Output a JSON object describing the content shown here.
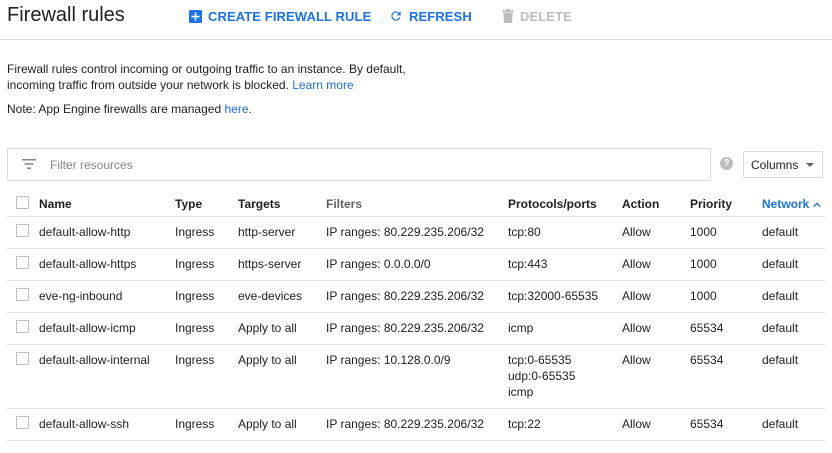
{
  "toolbar": {
    "title": "Firewall rules",
    "create_label": "CREATE FIREWALL RULE",
    "refresh_label": "REFRESH",
    "delete_label": "DELETE"
  },
  "description": {
    "line1": "Firewall rules control incoming or outgoing traffic to an instance. By default,",
    "line2": "incoming traffic from outside your network is blocked.",
    "learn_more": "Learn more"
  },
  "note": {
    "prefix": "Note: App Engine firewalls are managed ",
    "link": "here",
    "suffix": "."
  },
  "filter": {
    "placeholder": "Filter resources",
    "help_symbol": "?"
  },
  "columns_button": "Columns",
  "table": {
    "headers": {
      "name": "Name",
      "type": "Type",
      "targets": "Targets",
      "filters": "Filters",
      "protocols": "Protocols/ports",
      "action": "Action",
      "priority": "Priority",
      "network": "Network"
    },
    "sort": {
      "column": "network",
      "direction": "ascending"
    },
    "rows": [
      {
        "name": "default-allow-http",
        "type": "Ingress",
        "targets": "http-server",
        "filters": "IP ranges: 80.229.235.206/32",
        "protocols": [
          "tcp:80"
        ],
        "action": "Allow",
        "priority": "1000",
        "network": "default"
      },
      {
        "name": "default-allow-https",
        "type": "Ingress",
        "targets": "https-server",
        "filters": "IP ranges: 0.0.0.0/0",
        "protocols": [
          "tcp:443"
        ],
        "action": "Allow",
        "priority": "1000",
        "network": "default"
      },
      {
        "name": "eve-ng-inbound",
        "type": "Ingress",
        "targets": "eve-devices",
        "filters": "IP ranges: 80.229.235.206/32",
        "protocols": [
          "tcp:32000-65535"
        ],
        "action": "Allow",
        "priority": "1000",
        "network": "default"
      },
      {
        "name": "default-allow-icmp",
        "type": "Ingress",
        "targets": "Apply to all",
        "filters": "IP ranges: 80.229.235.206/32",
        "protocols": [
          "icmp"
        ],
        "action": "Allow",
        "priority": "65534",
        "network": "default"
      },
      {
        "name": "default-allow-internal",
        "type": "Ingress",
        "targets": "Apply to all",
        "filters": "IP ranges: 10.128.0.0/9",
        "protocols": [
          "tcp:0-65535",
          "udp:0-65535",
          "icmp"
        ],
        "action": "Allow",
        "priority": "65534",
        "network": "default"
      },
      {
        "name": "default-allow-ssh",
        "type": "Ingress",
        "targets": "Apply to all",
        "filters": "IP ranges: 80.229.235.206/32",
        "protocols": [
          "tcp:22"
        ],
        "action": "Allow",
        "priority": "65534",
        "network": "default"
      }
    ]
  },
  "colors": {
    "accent": "#1a73e8",
    "text": "#202124",
    "secondary_text": "#5f6368",
    "disabled": "#bdbdbd",
    "divider": "#e0e0e0"
  },
  "icons": {
    "create": "add-box-icon",
    "refresh": "refresh-icon",
    "delete": "trash-icon",
    "filter": "filter-list-icon",
    "help": "help-icon",
    "sort": "sort-ascending-icon"
  }
}
